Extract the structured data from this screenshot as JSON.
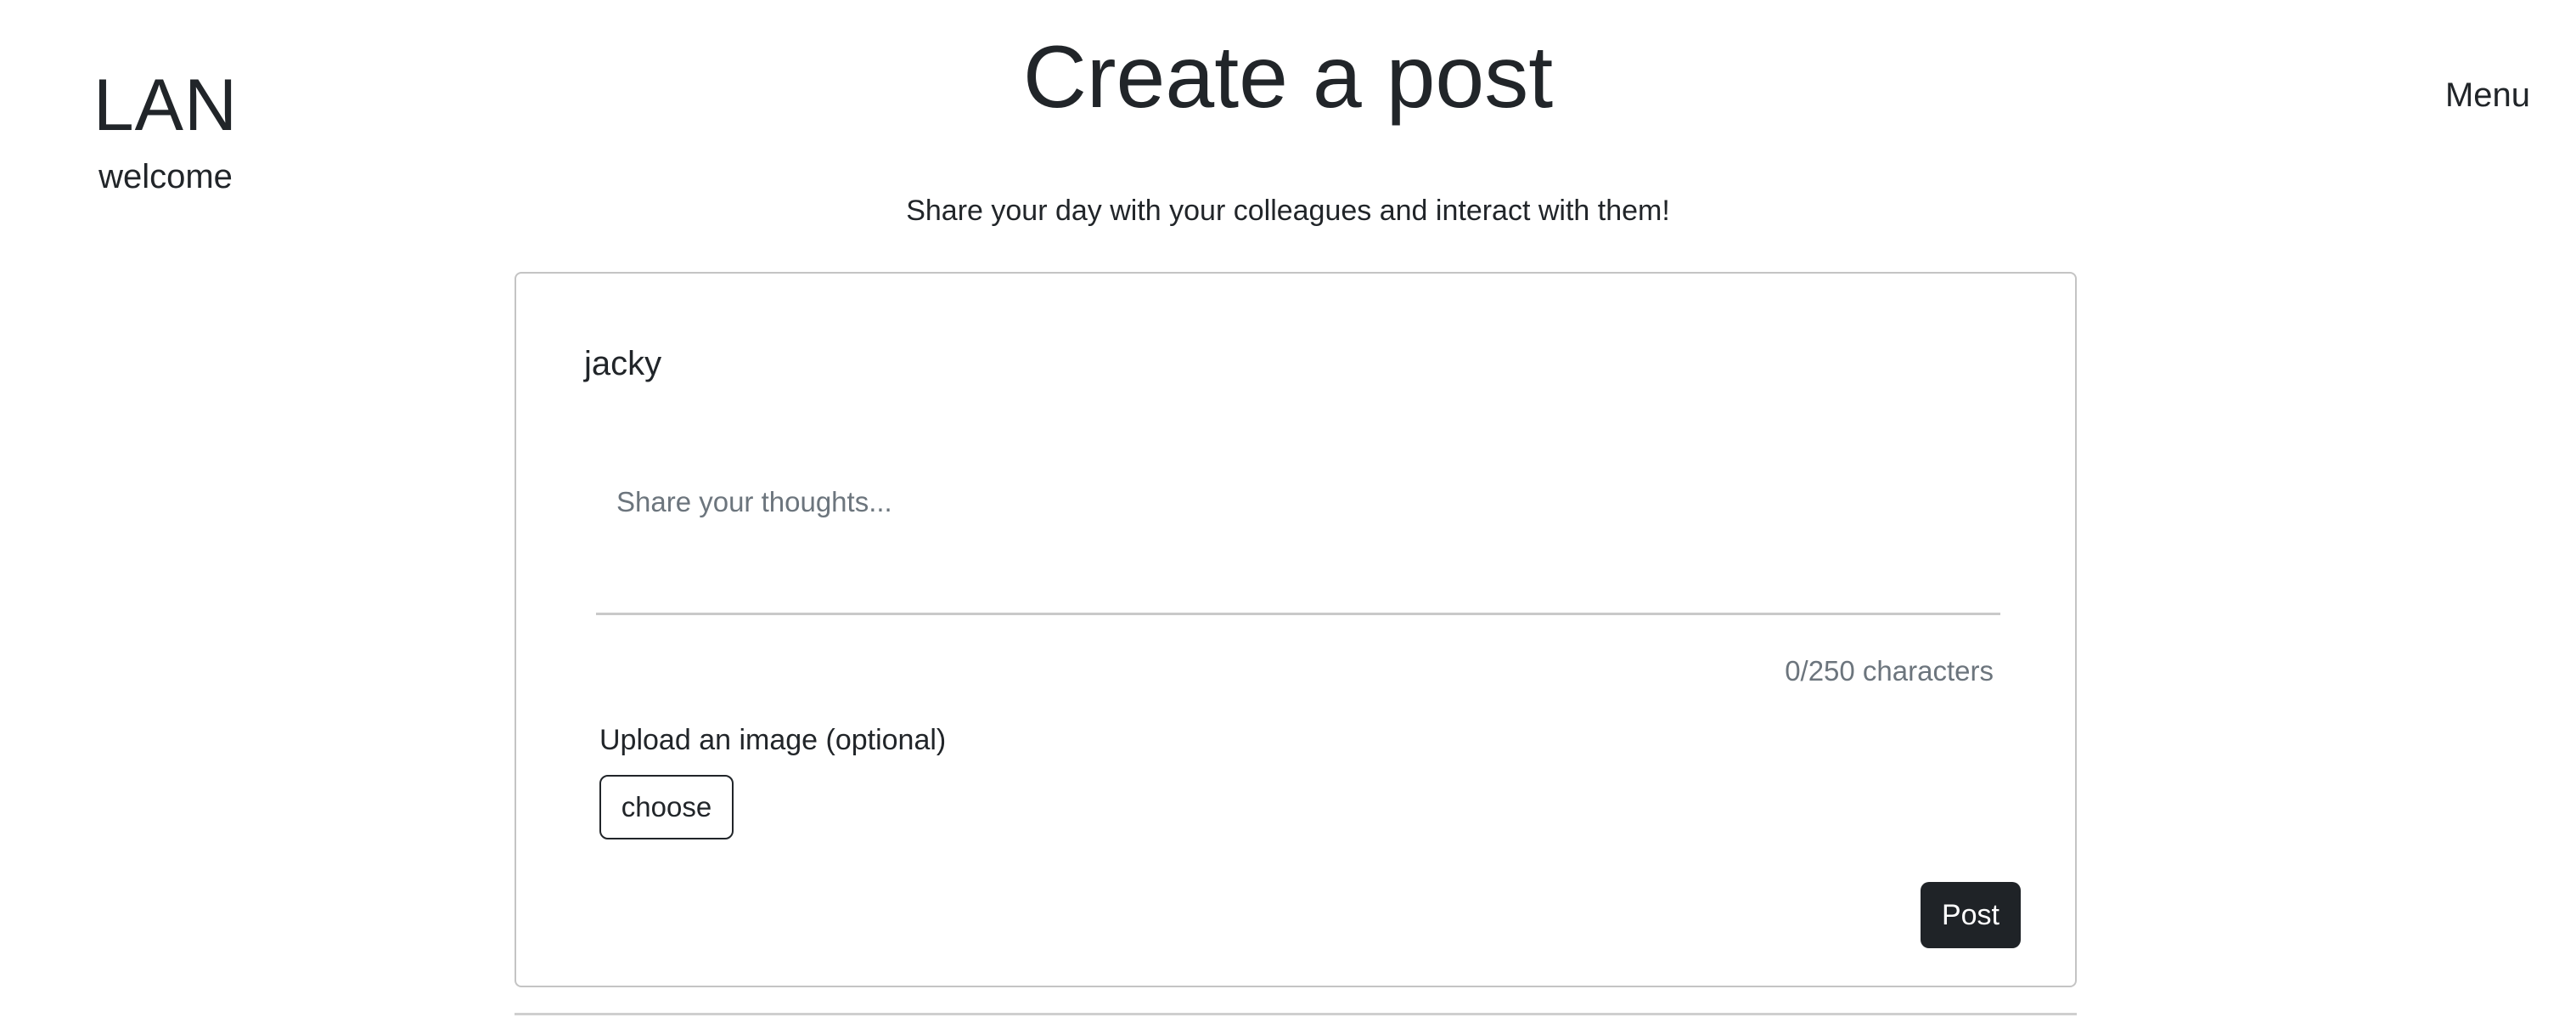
{
  "header": {
    "brand_title": "LAN",
    "brand_subtitle": "welcome",
    "menu_label": "Menu"
  },
  "main": {
    "title": "Create a post",
    "lead": "Share your day with your colleagues and interact with them!"
  },
  "post_form": {
    "author": "jacky",
    "thoughts_value": "",
    "thoughts_placeholder": "Share your thoughts...",
    "char_count": "0/250 characters",
    "upload_label": "Upload an image (optional)",
    "choose_label": "choose",
    "post_label": "Post"
  }
}
